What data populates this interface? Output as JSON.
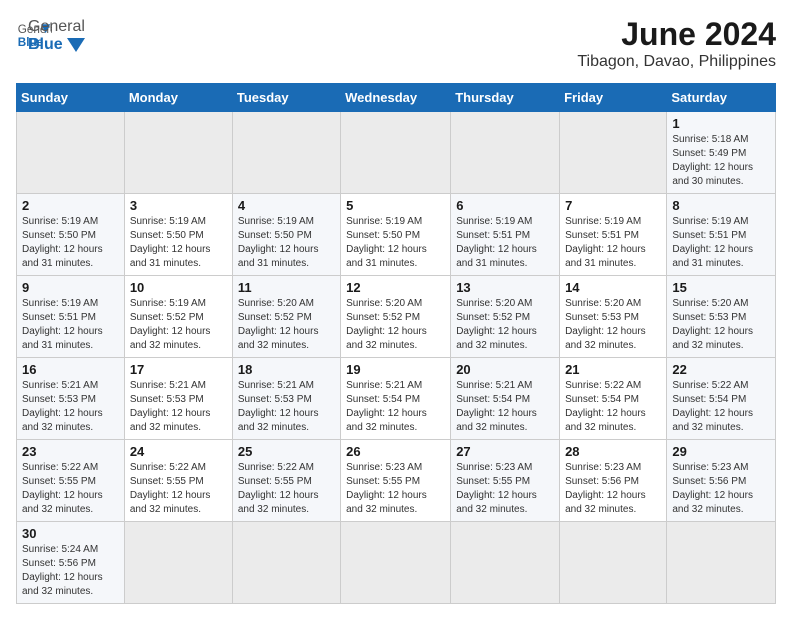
{
  "logo": {
    "text_general": "General",
    "text_blue": "Blue"
  },
  "title": "June 2024",
  "subtitle": "Tibagon, Davao, Philippines",
  "weekdays": [
    "Sunday",
    "Monday",
    "Tuesday",
    "Wednesday",
    "Thursday",
    "Friday",
    "Saturday"
  ],
  "weeks": [
    {
      "days": [
        {
          "num": "",
          "info": ""
        },
        {
          "num": "",
          "info": ""
        },
        {
          "num": "",
          "info": ""
        },
        {
          "num": "",
          "info": ""
        },
        {
          "num": "",
          "info": ""
        },
        {
          "num": "",
          "info": ""
        },
        {
          "num": "1",
          "info": "Sunrise: 5:18 AM\nSunset: 5:49 PM\nDaylight: 12 hours and 30 minutes."
        }
      ]
    },
    {
      "days": [
        {
          "num": "2",
          "info": "Sunrise: 5:19 AM\nSunset: 5:50 PM\nDaylight: 12 hours and 31 minutes."
        },
        {
          "num": "3",
          "info": "Sunrise: 5:19 AM\nSunset: 5:50 PM\nDaylight: 12 hours and 31 minutes."
        },
        {
          "num": "4",
          "info": "Sunrise: 5:19 AM\nSunset: 5:50 PM\nDaylight: 12 hours and 31 minutes."
        },
        {
          "num": "5",
          "info": "Sunrise: 5:19 AM\nSunset: 5:50 PM\nDaylight: 12 hours and 31 minutes."
        },
        {
          "num": "6",
          "info": "Sunrise: 5:19 AM\nSunset: 5:51 PM\nDaylight: 12 hours and 31 minutes."
        },
        {
          "num": "7",
          "info": "Sunrise: 5:19 AM\nSunset: 5:51 PM\nDaylight: 12 hours and 31 minutes."
        },
        {
          "num": "8",
          "info": "Sunrise: 5:19 AM\nSunset: 5:51 PM\nDaylight: 12 hours and 31 minutes."
        }
      ]
    },
    {
      "days": [
        {
          "num": "9",
          "info": "Sunrise: 5:19 AM\nSunset: 5:51 PM\nDaylight: 12 hours and 31 minutes."
        },
        {
          "num": "10",
          "info": "Sunrise: 5:19 AM\nSunset: 5:52 PM\nDaylight: 12 hours and 32 minutes."
        },
        {
          "num": "11",
          "info": "Sunrise: 5:20 AM\nSunset: 5:52 PM\nDaylight: 12 hours and 32 minutes."
        },
        {
          "num": "12",
          "info": "Sunrise: 5:20 AM\nSunset: 5:52 PM\nDaylight: 12 hours and 32 minutes."
        },
        {
          "num": "13",
          "info": "Sunrise: 5:20 AM\nSunset: 5:52 PM\nDaylight: 12 hours and 32 minutes."
        },
        {
          "num": "14",
          "info": "Sunrise: 5:20 AM\nSunset: 5:53 PM\nDaylight: 12 hours and 32 minutes."
        },
        {
          "num": "15",
          "info": "Sunrise: 5:20 AM\nSunset: 5:53 PM\nDaylight: 12 hours and 32 minutes."
        }
      ]
    },
    {
      "days": [
        {
          "num": "16",
          "info": "Sunrise: 5:21 AM\nSunset: 5:53 PM\nDaylight: 12 hours and 32 minutes."
        },
        {
          "num": "17",
          "info": "Sunrise: 5:21 AM\nSunset: 5:53 PM\nDaylight: 12 hours and 32 minutes."
        },
        {
          "num": "18",
          "info": "Sunrise: 5:21 AM\nSunset: 5:53 PM\nDaylight: 12 hours and 32 minutes."
        },
        {
          "num": "19",
          "info": "Sunrise: 5:21 AM\nSunset: 5:54 PM\nDaylight: 12 hours and 32 minutes."
        },
        {
          "num": "20",
          "info": "Sunrise: 5:21 AM\nSunset: 5:54 PM\nDaylight: 12 hours and 32 minutes."
        },
        {
          "num": "21",
          "info": "Sunrise: 5:22 AM\nSunset: 5:54 PM\nDaylight: 12 hours and 32 minutes."
        },
        {
          "num": "22",
          "info": "Sunrise: 5:22 AM\nSunset: 5:54 PM\nDaylight: 12 hours and 32 minutes."
        }
      ]
    },
    {
      "days": [
        {
          "num": "23",
          "info": "Sunrise: 5:22 AM\nSunset: 5:55 PM\nDaylight: 12 hours and 32 minutes."
        },
        {
          "num": "24",
          "info": "Sunrise: 5:22 AM\nSunset: 5:55 PM\nDaylight: 12 hours and 32 minutes."
        },
        {
          "num": "25",
          "info": "Sunrise: 5:22 AM\nSunset: 5:55 PM\nDaylight: 12 hours and 32 minutes."
        },
        {
          "num": "26",
          "info": "Sunrise: 5:23 AM\nSunset: 5:55 PM\nDaylight: 12 hours and 32 minutes."
        },
        {
          "num": "27",
          "info": "Sunrise: 5:23 AM\nSunset: 5:55 PM\nDaylight: 12 hours and 32 minutes."
        },
        {
          "num": "28",
          "info": "Sunrise: 5:23 AM\nSunset: 5:56 PM\nDaylight: 12 hours and 32 minutes."
        },
        {
          "num": "29",
          "info": "Sunrise: 5:23 AM\nSunset: 5:56 PM\nDaylight: 12 hours and 32 minutes."
        }
      ]
    },
    {
      "days": [
        {
          "num": "30",
          "info": "Sunrise: 5:24 AM\nSunset: 5:56 PM\nDaylight: 12 hours and 32 minutes."
        },
        {
          "num": "",
          "info": ""
        },
        {
          "num": "",
          "info": ""
        },
        {
          "num": "",
          "info": ""
        },
        {
          "num": "",
          "info": ""
        },
        {
          "num": "",
          "info": ""
        },
        {
          "num": "",
          "info": ""
        }
      ]
    }
  ],
  "colors": {
    "header_bg": "#1a6bb5",
    "header_text": "#ffffff",
    "cell_odd": "#f5f7fa",
    "cell_even": "#ffffff",
    "empty_cell": "#ebebeb"
  }
}
